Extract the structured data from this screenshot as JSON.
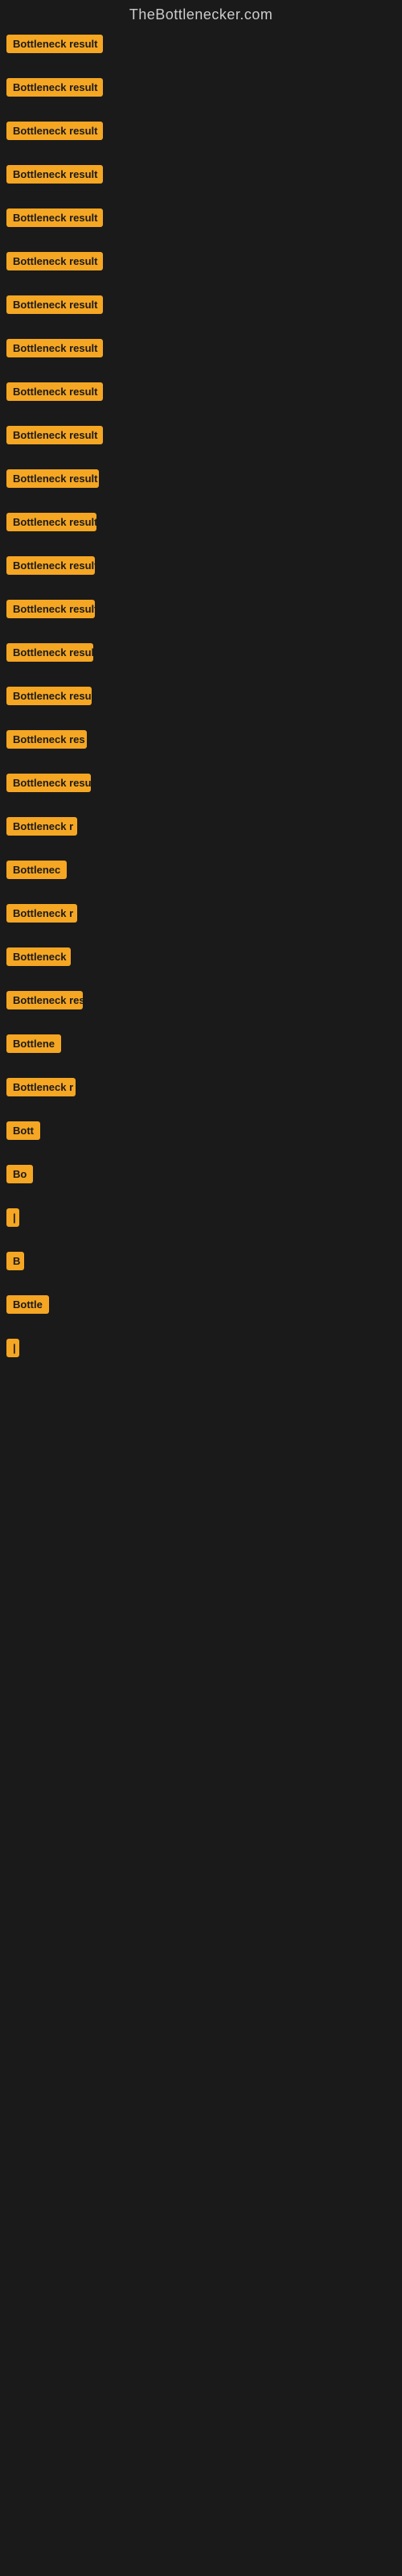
{
  "site": {
    "title": "TheBottlenecker.com"
  },
  "items": [
    {
      "label": "Bottleneck result",
      "width": 120
    },
    {
      "label": "Bottleneck result",
      "width": 120
    },
    {
      "label": "Bottleneck result",
      "width": 120
    },
    {
      "label": "Bottleneck result",
      "width": 120
    },
    {
      "label": "Bottleneck result",
      "width": 120
    },
    {
      "label": "Bottleneck result",
      "width": 120
    },
    {
      "label": "Bottleneck result",
      "width": 120
    },
    {
      "label": "Bottleneck result",
      "width": 120
    },
    {
      "label": "Bottleneck result",
      "width": 120
    },
    {
      "label": "Bottleneck result",
      "width": 120
    },
    {
      "label": "Bottleneck result",
      "width": 115
    },
    {
      "label": "Bottleneck result",
      "width": 112
    },
    {
      "label": "Bottleneck result",
      "width": 110
    },
    {
      "label": "Bottleneck result",
      "width": 110
    },
    {
      "label": "Bottleneck result",
      "width": 108
    },
    {
      "label": "Bottleneck result",
      "width": 106
    },
    {
      "label": "Bottleneck res",
      "width": 100
    },
    {
      "label": "Bottleneck result",
      "width": 105
    },
    {
      "label": "Bottleneck r",
      "width": 88
    },
    {
      "label": "Bottlenec",
      "width": 78
    },
    {
      "label": "Bottleneck r",
      "width": 88
    },
    {
      "label": "Bottleneck",
      "width": 80
    },
    {
      "label": "Bottleneck res",
      "width": 95
    },
    {
      "label": "Bottlene",
      "width": 72
    },
    {
      "label": "Bottleneck r",
      "width": 86
    },
    {
      "label": "Bott",
      "width": 48
    },
    {
      "label": "Bo",
      "width": 36
    },
    {
      "label": "|",
      "width": 12
    },
    {
      "label": "B",
      "width": 22
    },
    {
      "label": "Bottle",
      "width": 55
    },
    {
      "label": "|",
      "width": 10
    }
  ]
}
